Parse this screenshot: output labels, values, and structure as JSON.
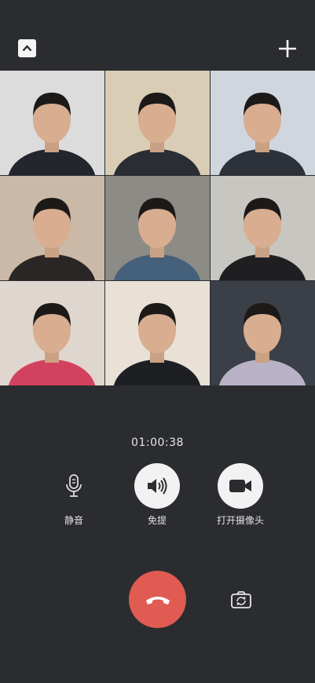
{
  "header": {
    "collapse_icon": "chevron-up-icon",
    "add_icon": "plus-icon"
  },
  "participants": [
    {
      "id": 1,
      "bg": "#dcdcdc",
      "shirt": "#23262d"
    },
    {
      "id": 2,
      "bg": "#d9cdb6",
      "shirt": "#2a2d33"
    },
    {
      "id": 3,
      "bg": "#cfd6de",
      "shirt": "#2d3139"
    },
    {
      "id": 4,
      "bg": "#c9b9a6",
      "shirt": "#2a2626"
    },
    {
      "id": 5,
      "bg": "#8d8b86",
      "shirt": "#45607a"
    },
    {
      "id": 6,
      "bg": "#c8c6c0",
      "shirt": "#1f1f22"
    },
    {
      "id": 7,
      "bg": "#e0d6d0",
      "shirt": "#d2425e"
    },
    {
      "id": 8,
      "bg": "#e9e1d6",
      "shirt": "#1e1f23"
    },
    {
      "id": 9,
      "bg": "#3b3f47",
      "shirt": "#b9b2c6"
    }
  ],
  "call": {
    "duration": "01:00:38"
  },
  "controls": {
    "mute_label": "静音",
    "speaker_label": "免提",
    "camera_label": "打开摄像头"
  },
  "colors": {
    "background": "#2b2c30",
    "hangup": "#e05b51",
    "button_light": "#f2f2f2"
  }
}
